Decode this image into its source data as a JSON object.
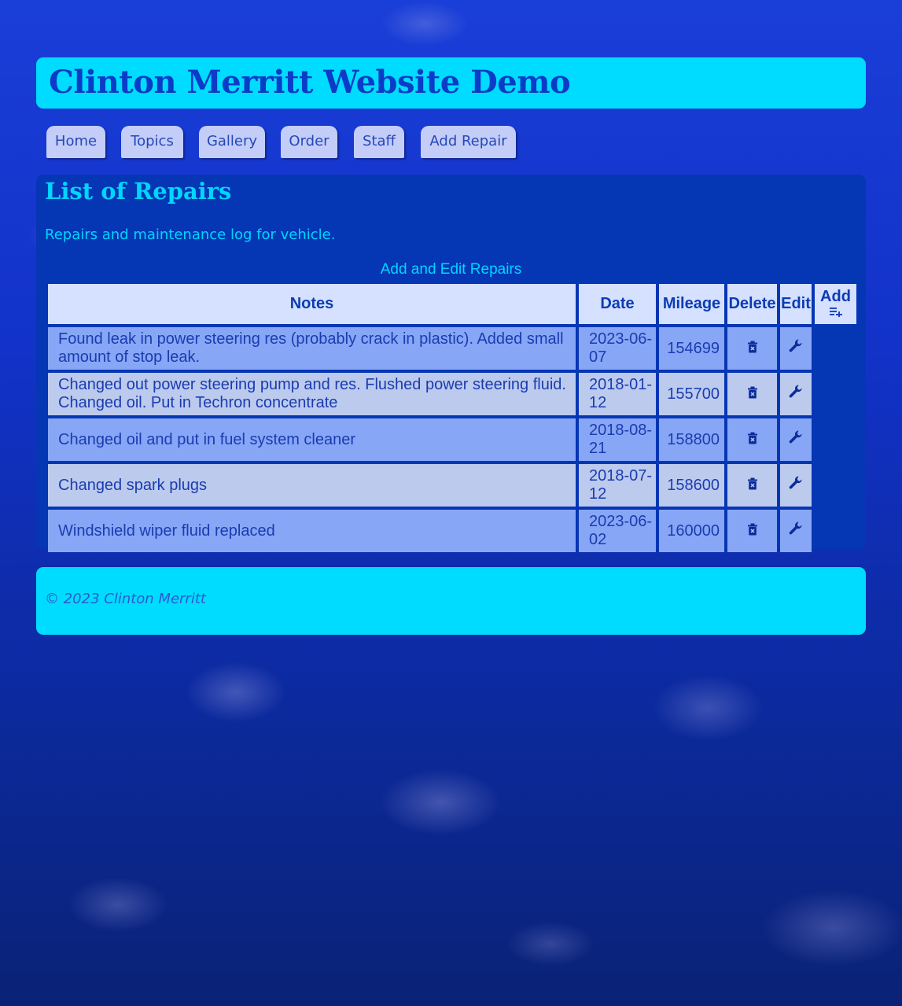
{
  "header": {
    "title": "Clinton Merritt Website Demo"
  },
  "nav": {
    "items": [
      {
        "label": "Home"
      },
      {
        "label": "Topics"
      },
      {
        "label": "Gallery"
      },
      {
        "label": "Order"
      },
      {
        "label": "Staff"
      },
      {
        "label": "Add Repair"
      }
    ]
  },
  "main": {
    "heading": "List of Repairs",
    "description": "Repairs and maintenance log for vehicle.",
    "table_caption": "Add and Edit Repairs",
    "columns": {
      "notes": "Notes",
      "date": "Date",
      "mileage": "Mileage",
      "delete": "Delete",
      "edit": "Edit",
      "add": "Add"
    },
    "rows": [
      {
        "notes": "Found leak in power steering res (probably crack in plastic). Added small amount of stop leak.",
        "date": "2023-06-07",
        "mileage": "154699"
      },
      {
        "notes": "Changed out power steering pump and res. Flushed power steering fluid. Changed oil. Put in Techron concentrate",
        "date": "2018-01-12",
        "mileage": "155700"
      },
      {
        "notes": "Changed oil and put in fuel system cleaner",
        "date": "2018-08-21",
        "mileage": "158800"
      },
      {
        "notes": "Changed spark plugs",
        "date": "2018-07-12",
        "mileage": "158600"
      },
      {
        "notes": "Windshield wiper fluid replaced",
        "date": "2023-06-02",
        "mileage": "160000"
      }
    ],
    "icons": {
      "delete": "trash-icon",
      "edit": "wrench-icon",
      "add": "playlist-add-icon"
    }
  },
  "footer": {
    "copyright": "© 2023 Clinton Merritt"
  },
  "colors": {
    "header_bg": "#00dcff",
    "panel_bg": "#0536b4",
    "accent_text": "#00d6ff",
    "nav_bg": "#c3cdf8",
    "row_odd": "#88a6f6",
    "row_even": "#bccaee"
  }
}
